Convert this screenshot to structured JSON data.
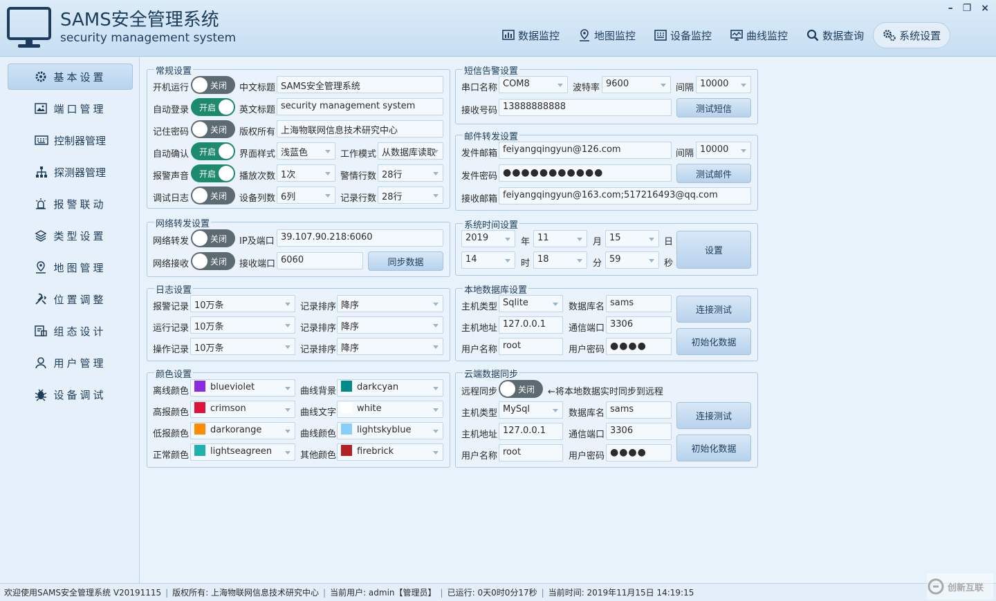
{
  "app": {
    "title": "SAMS安全管理系统",
    "subtitle": "security management system"
  },
  "nav": [
    {
      "label": "数据监控",
      "icon": "bar-chart-icon"
    },
    {
      "label": "地图监控",
      "icon": "map-marker-icon"
    },
    {
      "label": "设备监控",
      "icon": "device-grid-icon"
    },
    {
      "label": "曲线监控",
      "icon": "monitor-curve-icon"
    },
    {
      "label": "数据查询",
      "icon": "search-icon"
    },
    {
      "label": "系统设置",
      "icon": "gears-icon",
      "active": true
    }
  ],
  "window_controls": {
    "minimize": "–",
    "restore": "❐",
    "close": "×"
  },
  "sidebar": [
    {
      "label": "基本设置",
      "icon": "gear-icon",
      "active": true
    },
    {
      "label": "端口管理",
      "icon": "image-icon"
    },
    {
      "label": "控制器管理",
      "icon": "keyboard-icon"
    },
    {
      "label": "探测器管理",
      "icon": "sitemap-icon"
    },
    {
      "label": "报警联动",
      "icon": "alarm-icon"
    },
    {
      "label": "类型设置",
      "icon": "layers-icon"
    },
    {
      "label": "地图管理",
      "icon": "map-marker-icon"
    },
    {
      "label": "位置调整",
      "icon": "tools-icon"
    },
    {
      "label": "组态设计",
      "icon": "design-icon"
    },
    {
      "label": "用户管理",
      "icon": "user-icon"
    },
    {
      "label": "设备调试",
      "icon": "bug-icon"
    }
  ],
  "general": {
    "title": "常规设置",
    "autorun": {
      "label": "开机运行",
      "state": "关闭"
    },
    "cn_title": {
      "label": "中文标题",
      "value": "SAMS安全管理系统"
    },
    "autologin": {
      "label": "自动登录",
      "state": "开启"
    },
    "en_title": {
      "label": "英文标题",
      "value": "security management system"
    },
    "remember": {
      "label": "记住密码",
      "state": "关闭"
    },
    "copyright": {
      "label": "版权所有",
      "value": "上海物联网信息技术研究中心"
    },
    "autoconfirm": {
      "label": "自动确认",
      "state": "开启"
    },
    "style": {
      "label": "界面样式",
      "value": "浅蓝色"
    },
    "workmode": {
      "label": "工作模式",
      "value": "从数据库读取"
    },
    "alarm_sound": {
      "label": "报警声音",
      "state": "开启"
    },
    "play_count": {
      "label": "播放次数",
      "value": "1次"
    },
    "alert_rows": {
      "label": "警情行数",
      "value": "28行"
    },
    "debug_log": {
      "label": "调试日志",
      "state": "关闭"
    },
    "device_cols": {
      "label": "设备列数",
      "value": "6列"
    },
    "record_rows": {
      "label": "记录行数",
      "value": "28行"
    }
  },
  "network": {
    "title": "网络转发设置",
    "forward": {
      "label": "网络转发",
      "state": "关闭"
    },
    "ip_port": {
      "label": "IP及端口",
      "value": "39.107.90.218:6060"
    },
    "receive": {
      "label": "网络接收",
      "state": "关闭"
    },
    "recv_port": {
      "label": "接收端口",
      "value": "6060"
    },
    "sync_button": "同步数据"
  },
  "log": {
    "title": "日志设置",
    "rows": [
      {
        "label": "报警记录",
        "value": "10万条",
        "sort_label": "记录排序",
        "sort": "降序"
      },
      {
        "label": "运行记录",
        "value": "10万条",
        "sort_label": "记录排序",
        "sort": "降序"
      },
      {
        "label": "操作记录",
        "value": "10万条",
        "sort_label": "记录排序",
        "sort": "降序"
      }
    ]
  },
  "colors": {
    "title": "颜色设置",
    "left": [
      {
        "label": "离线颜色",
        "value": "blueviolet",
        "hex": "#8a2be2"
      },
      {
        "label": "高报颜色",
        "value": "crimson",
        "hex": "#dc143c"
      },
      {
        "label": "低报颜色",
        "value": "darkorange",
        "hex": "#ff8c00"
      },
      {
        "label": "正常颜色",
        "value": "lightseagreen",
        "hex": "#20b2aa"
      }
    ],
    "right": [
      {
        "label": "曲线背景",
        "value": "darkcyan",
        "hex": "#008b8b"
      },
      {
        "label": "曲线文字",
        "value": "white",
        "hex": "#ffffff"
      },
      {
        "label": "曲线颜色",
        "value": "lightskyblue",
        "hex": "#87cefa"
      },
      {
        "label": "其他颜色",
        "value": "firebrick",
        "hex": "#b22222"
      }
    ]
  },
  "sms": {
    "title": "短信告警设置",
    "port": {
      "label": "串口名称",
      "value": "COM8"
    },
    "baud": {
      "label": "波特率",
      "value": "9600"
    },
    "interval": {
      "label": "间隔",
      "value": "10000"
    },
    "phone": {
      "label": "接收号码",
      "value": "13888888888"
    },
    "test_button": "测试短信"
  },
  "mail": {
    "title": "邮件转发设置",
    "sender": {
      "label": "发件邮箱",
      "value": "feiyangqingyun@126.com"
    },
    "interval": {
      "label": "间隔",
      "value": "10000"
    },
    "password": {
      "label": "发件密码",
      "value": "●●●●●●●●●●●"
    },
    "test_button": "测试邮件",
    "receiver": {
      "label": "接收邮箱",
      "value": "feiyangqingyun@163.com;517216493@qq.com"
    }
  },
  "time": {
    "title": "系统时间设置",
    "year": "2019",
    "year_unit": "年",
    "month": "11",
    "month_unit": "月",
    "day": "15",
    "day_unit": "日",
    "hour": "14",
    "hour_unit": "时",
    "minute": "18",
    "minute_unit": "分",
    "second": "59",
    "second_unit": "秒",
    "set_button": "设置"
  },
  "localdb": {
    "title": "本地数据库设置",
    "type": {
      "label": "主机类型",
      "value": "Sqlite"
    },
    "dbname": {
      "label": "数据库名",
      "value": "sams"
    },
    "host": {
      "label": "主机地址",
      "value": "127.0.0.1"
    },
    "port": {
      "label": "通信端口",
      "value": "3306"
    },
    "user": {
      "label": "用户名称",
      "value": "root"
    },
    "pwd": {
      "label": "用户密码",
      "value": "●●●●"
    },
    "test_button": "连接测试",
    "init_button": "初始化数据"
  },
  "cloud": {
    "title": "云端数据同步",
    "remote": {
      "label": "远程同步",
      "state": "关闭"
    },
    "hint": "←将本地数据实时同步到远程",
    "type": {
      "label": "主机类型",
      "value": "MySql"
    },
    "dbname": {
      "label": "数据库名",
      "value": "sams"
    },
    "host": {
      "label": "主机地址",
      "value": "127.0.0.1"
    },
    "port": {
      "label": "通信端口",
      "value": "3306"
    },
    "user": {
      "label": "用户名称",
      "value": "root"
    },
    "pwd": {
      "label": "用户密码",
      "value": "●●●●"
    },
    "test_button": "连接测试",
    "init_button": "初始化数据"
  },
  "status": {
    "welcome": "欢迎使用SAMS安全管理系统 V20191115",
    "copyright": "版权所有: 上海物联网信息技术研究中心",
    "user": "当前用户: admin【管理员】",
    "uptime": "已运行: 0天0时0分17秒",
    "now": "当前时间: 2019年11月15日 14:19:15"
  },
  "watermark": "创新互联"
}
